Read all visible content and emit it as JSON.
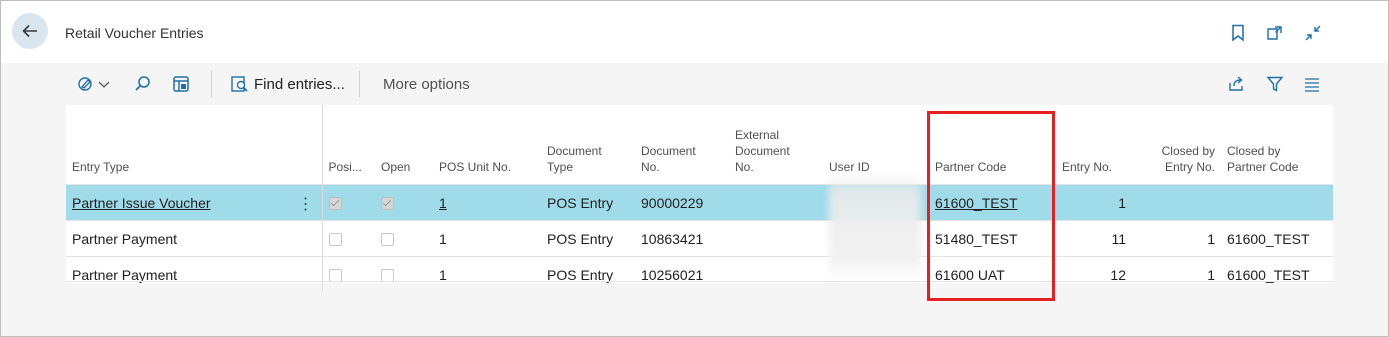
{
  "window": {
    "title": "Retail Voucher Entries"
  },
  "toolbar": {
    "find_label": "Find entries...",
    "more_label": "More options"
  },
  "table": {
    "headers": {
      "entry_type": "Entry Type",
      "posi": "Posi...",
      "open": "Open",
      "pos_unit": "POS Unit No.",
      "doc_type_1": "Document",
      "doc_type_2": "Type",
      "doc_no_1": "Document",
      "doc_no_2": "No.",
      "ext_1": "External",
      "ext_2": "Document",
      "ext_3": "No.",
      "user_id": "User ID",
      "partner_code": "Partner Code",
      "entry_no": "Entry No.",
      "closed_entry_1": "Closed by",
      "closed_entry_2": "Entry No.",
      "closed_partner_1": "Closed by",
      "closed_partner_2": "Partner Code"
    },
    "rows": [
      {
        "entry_type": "Partner Issue Voucher",
        "posi": true,
        "open": true,
        "pos_unit": "1",
        "doc_type": "POS Entry",
        "doc_no": "90000229",
        "ext_doc": "",
        "user_id": "",
        "partner_code": "61600_TEST",
        "entry_no": "1",
        "closed_entry": "",
        "closed_partner": ""
      },
      {
        "entry_type": "Partner Payment",
        "posi": false,
        "open": false,
        "pos_unit": "1",
        "doc_type": "POS Entry",
        "doc_no": "10863421",
        "ext_doc": "",
        "user_id": "",
        "partner_code": "51480_TEST",
        "entry_no": "11",
        "closed_entry": "1",
        "closed_partner": "61600_TEST"
      },
      {
        "entry_type": "Partner Payment",
        "posi": false,
        "open": false,
        "pos_unit": "1",
        "doc_type": "POS Entry",
        "doc_no": "10256021",
        "ext_doc": "",
        "user_id": "",
        "partner_code": "61600 UAT",
        "entry_no": "12",
        "closed_entry": "1",
        "closed_partner": "61600_TEST"
      }
    ]
  },
  "colors": {
    "selected_row": "#9fdbe8",
    "highlight_box": "#e52020",
    "accent": "#1f6fa8"
  },
  "icons": {
    "back": "back-arrow-icon",
    "bookmark": "bookmark-icon",
    "open_new": "open-in-new-window-icon",
    "collapse": "collapse-icon",
    "edit_mode": "edit-mode-icon",
    "search": "search-icon",
    "filter_pane": "filter-pane-icon",
    "find": "find-entries-icon",
    "share": "share-icon",
    "filter": "filter-icon",
    "list": "list-view-icon"
  }
}
